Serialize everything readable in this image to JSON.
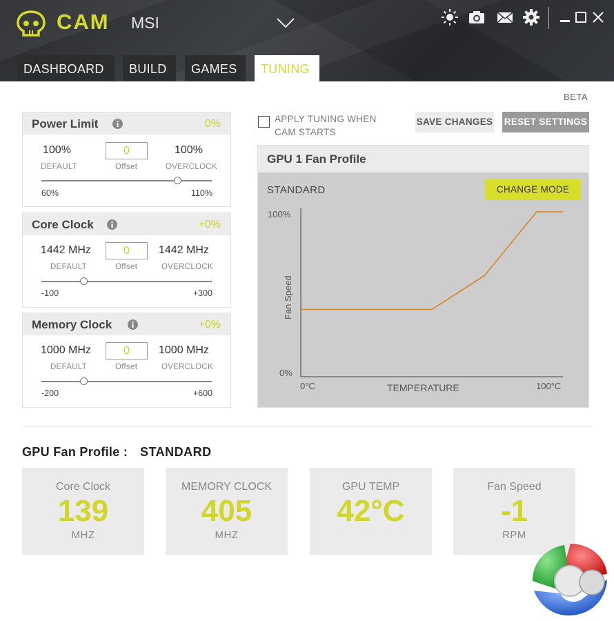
{
  "header": {
    "brand": "CAM",
    "model": "MSI",
    "tabs": [
      {
        "label": "DASHBOARD",
        "active": false
      },
      {
        "label": "BUILD",
        "active": false
      },
      {
        "label": "GAMES",
        "active": false
      },
      {
        "label": "TUNING",
        "active": true
      }
    ],
    "icons": [
      "brightness-icon",
      "camera-icon",
      "mail-icon",
      "gear-icon",
      "minimize-icon",
      "maximize-icon",
      "close-icon"
    ],
    "accent_color": "#d4db2a"
  },
  "beta_label": "BETA",
  "panels": [
    {
      "title": "Power Limit",
      "percent": "0%",
      "default_value": "100%",
      "default_label": "DEFAULT",
      "offset_value": "0",
      "offset_label": "Offset",
      "overclock_value": "100%",
      "overclock_label": "OVERCLOCK",
      "range_min": "60%",
      "range_max": "110%",
      "slider_fraction": 0.8
    },
    {
      "title": "Core Clock",
      "percent": "+0%",
      "default_value": "1442 MHz",
      "default_label": "DEFAULT",
      "offset_value": "0",
      "offset_label": "Offset",
      "overclock_value": "1442 MHz",
      "overclock_label": "OVERCLOCK",
      "range_min": "-100",
      "range_max": "+300",
      "slider_fraction": 0.25
    },
    {
      "title": "Memory Clock",
      "percent": "+0%",
      "default_value": "1000 MHz",
      "default_label": "DEFAULT",
      "offset_value": "0",
      "offset_label": "Offset",
      "overclock_value": "1000 MHz",
      "overclock_label": "OVERCLOCK",
      "range_min": "-200",
      "range_max": "+600",
      "slider_fraction": 0.25
    }
  ],
  "apply_tuning": {
    "label_line1": "APPLY TUNING WHEN",
    "label_line2": "CAM STARTS",
    "checked": false
  },
  "buttons": {
    "save": "SAVE CHANGES",
    "reset": "RESET SETTINGS",
    "change_mode": "CHANGE MODE"
  },
  "fan_profile": {
    "title": "GPU 1 Fan Profile",
    "mode": "STANDARD",
    "y_top_label": "100%",
    "y_bottom_label": "0%",
    "y_axis_label": "Fan Speed",
    "x_left_label": "0°C",
    "x_right_label": "100°C",
    "x_axis_label": "TEMPERATURE",
    "line_color": "#d4862a"
  },
  "chart_data": {
    "type": "line",
    "xlabel": "TEMPERATURE",
    "ylabel": "Fan Speed",
    "xlim": [
      0,
      100
    ],
    "ylim": [
      0,
      100
    ],
    "series": [
      {
        "x": [
          0,
          50,
          70,
          90,
          100
        ],
        "y": [
          40,
          40,
          60,
          98,
          98
        ]
      }
    ]
  },
  "summary": {
    "profile_label": "GPU Fan Profile :",
    "profile_value": "STANDARD",
    "stats": [
      {
        "label": "Core Clock",
        "value": "139",
        "unit": "MHZ"
      },
      {
        "label": "MEMORY CLOCK",
        "value": "405",
        "unit": "MHZ"
      },
      {
        "label": "GPU TEMP",
        "value": "42°C",
        "unit": ""
      },
      {
        "label": "Fan Speed",
        "value": "-1",
        "unit": "RPM"
      }
    ]
  }
}
